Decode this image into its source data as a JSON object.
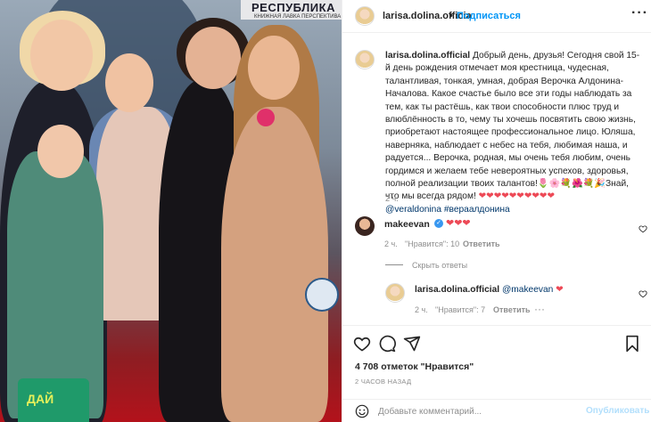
{
  "photo": {
    "banner_title": "РЕСПУБЛИКА",
    "banner_sub": "КНИЖНАЯ ЛАВКА ПЕРСПЕКТИВА",
    "sign_text": "ДАЙ"
  },
  "header": {
    "username": "larisa.dolina.officia",
    "separator": "•",
    "follow_label": "Подписаться",
    "more_label": "···"
  },
  "caption": {
    "username": "larisa.dolina.official",
    "text": " Добрый день, друзья! Сегодня свой 15-й день рождения отмечает моя крестница, чудесная, талантливая, тонкая, умная, добрая Верочка Алдонина-Началова. Какое счастье было все эти годы наблюдать за тем, как ты растёшь, как твои способности плюс труд и влюблённость в то, чему ты хочешь посвятить свою жизнь, приобретают настоящее профессиональное лицо. Юляша, наверняка, наблюдает с небес на тебя, любимая наша, и радуется... Верочка, родная, мы очень тебя любим, очень гордимся и желаем тебе невероятных успехов, здоровья, полной реализации твоих талантов!🌷🌸💐🌺💐🎉Знай, что мы всегда рядом! ",
    "hearts": "❤❤❤❤❤❤❤❤❤❤",
    "mention": "@veraldonina",
    "hashtag": "#вераалдонина",
    "time": "2 ч."
  },
  "comments": [
    {
      "username": "makeevan",
      "verified_icon": "✓",
      "text": "❤❤❤",
      "time": "2 ч.",
      "likes": "\"Нравится\": 10",
      "reply": "Ответить"
    },
    {
      "username": "larisa.dolina.official",
      "mention": "@makeevan",
      "heart": "❤",
      "time": "2 ч.",
      "likes": "\"Нравится\": 7",
      "reply": "Ответить",
      "more": "···"
    }
  ],
  "hide_replies": "Скрыть ответы",
  "likes_count": "4 708 отметок \"Нравится\"",
  "posted_ago": "2 ЧАСОВ НАЗАД",
  "comment_box": {
    "placeholder": "Добавьте комментарий...",
    "publish_label": "Опубликовать"
  },
  "colors": {
    "accent": "#0095f6",
    "heart": "#ed4956",
    "muted": "#8e8e8e"
  }
}
